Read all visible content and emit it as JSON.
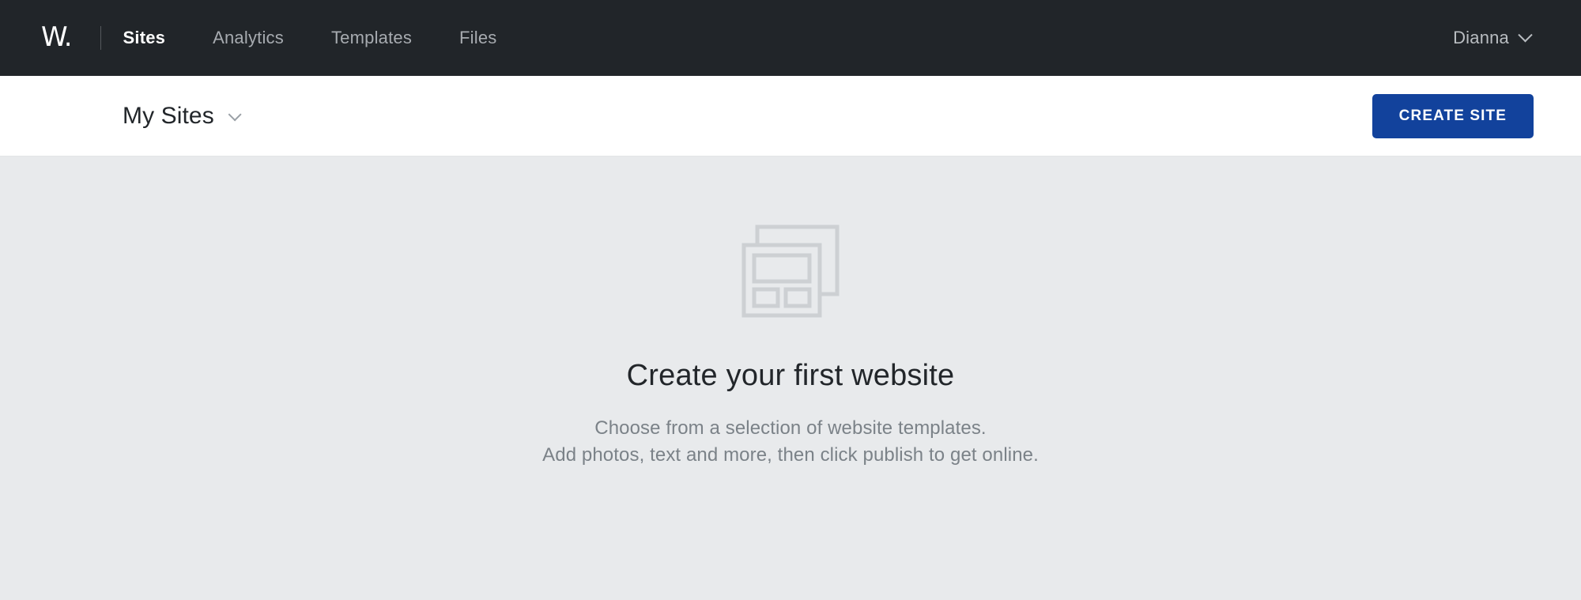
{
  "topbar": {
    "logo_text": "W.",
    "nav": [
      {
        "label": "Sites",
        "active": true
      },
      {
        "label": "Analytics",
        "active": false
      },
      {
        "label": "Templates",
        "active": false
      },
      {
        "label": "Files",
        "active": false
      }
    ],
    "user": {
      "name": "Dianna",
      "chevron_icon": "chevron-down-icon"
    }
  },
  "subheader": {
    "title": "My Sites",
    "title_chevron_icon": "chevron-down-icon",
    "create_button_label": "CREATE SITE"
  },
  "empty_state": {
    "icon": "website-layout-icon",
    "title": "Create your first website",
    "line1": "Choose from a selection of website templates.",
    "line2": "Add photos, text and more, then click publish to get online."
  },
  "colors": {
    "topbar_bg": "#212529",
    "subbar_bg": "#ffffff",
    "page_bg": "#e8eaec",
    "accent_blue": "#12429c",
    "nav_inactive": "#a7abb0",
    "nav_active": "#ffffff",
    "muted_text": "#7b8288",
    "icon_stroke": "#cdd0d3"
  }
}
